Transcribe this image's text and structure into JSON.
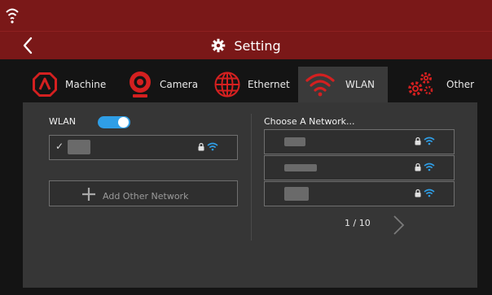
{
  "header": {
    "title": "Setting"
  },
  "tabs": [
    {
      "label": "Machine",
      "icon": "machine-icon",
      "active": false
    },
    {
      "label": "Camera",
      "icon": "camera-icon",
      "active": false
    },
    {
      "label": "Ethernet",
      "icon": "ethernet-globe-icon",
      "active": false
    },
    {
      "label": "WLAN",
      "icon": "wifi-icon",
      "active": true
    },
    {
      "label": "Other",
      "icon": "gears-icon",
      "active": false
    }
  ],
  "wlan": {
    "label": "WLAN",
    "toggle_on": true,
    "connected_network": {
      "check": "✓",
      "locked": true
    },
    "add_network_label": "Add Other Network"
  },
  "networks": {
    "heading": "Choose A Network...",
    "items": [
      {
        "locked": true
      },
      {
        "locked": true
      },
      {
        "locked": true
      }
    ],
    "page_indicator": "1 / 10"
  },
  "colors": {
    "brand_red": "#7a1818",
    "panel_bg": "#363636",
    "accent_blue": "#2f9ee6",
    "tab_icon_red": "#d42020"
  }
}
